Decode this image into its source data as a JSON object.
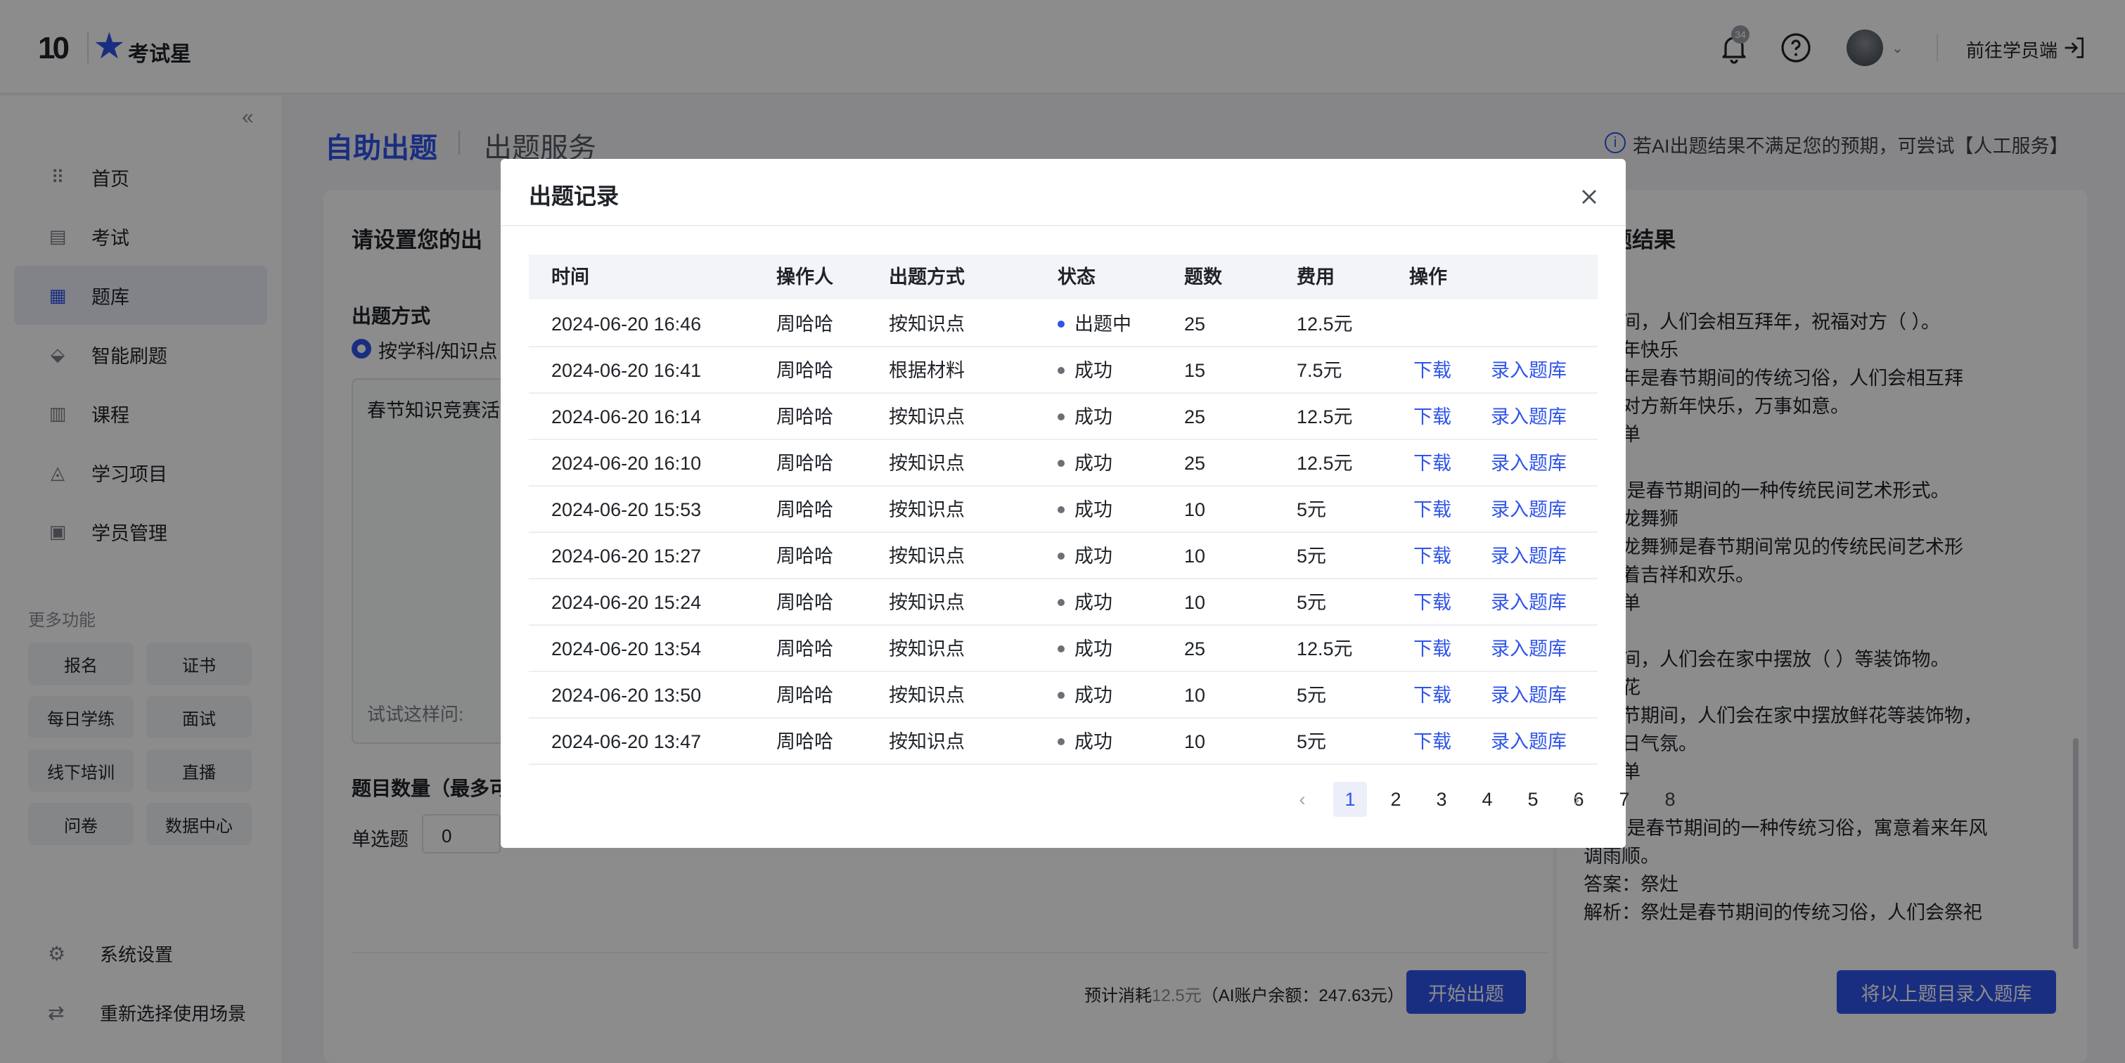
{
  "header": {
    "logo_mark": "10",
    "logo_text": "考试星",
    "notification_count": "34",
    "to_student": "前往学员端"
  },
  "sidebar": {
    "items": [
      {
        "label": "首页",
        "icon": "grid-icon"
      },
      {
        "label": "考试",
        "icon": "exam-icon"
      },
      {
        "label": "题库",
        "icon": "question-bank-icon"
      },
      {
        "label": "智能刷题",
        "icon": "smart-practice-icon"
      },
      {
        "label": "课程",
        "icon": "course-icon"
      },
      {
        "label": "学习项目",
        "icon": "project-icon"
      },
      {
        "label": "学员管理",
        "icon": "student-icon"
      }
    ],
    "more_title": "更多功能",
    "more": [
      "报名",
      "证书",
      "每日学练",
      "面试",
      "线下培训",
      "直播",
      "问卷",
      "数据中心"
    ],
    "footer": [
      {
        "label": "系统设置",
        "icon": "gear-icon"
      },
      {
        "label": "重新选择使用场景",
        "icon": "switch-icon"
      }
    ]
  },
  "page": {
    "title_main": "自助出题",
    "title_sub": "出题服务",
    "notice": "若AI出题结果不满足您的预期，可尝试【人工服务】",
    "card_title": "请设置您的出",
    "mode_label": "出题方式",
    "mode_option": "按学科/知识点",
    "topic_text": "春节知识竞赛活",
    "try_text": "试试这样问:",
    "qty_label": "题目数量（最多可",
    "single_label": "单选题",
    "single_value": "0",
    "cost_prefix": "预计消耗",
    "cost_amount": "12.5元",
    "cost_suffix": "（AI账户余额：247.63元）",
    "start_button": "开始出题",
    "result_title": "题结果",
    "result_lines": [
      "节期间，人们会相互拜年，祝福对方（ ）。",
      "：新年快乐",
      "：拜年是春节期间的传统习俗，人们会相互拜",
      "祝福对方新年快乐，万事如意。",
      "：简单",
      "",
      "（ ）是春节期间的一种传统民间艺术形式。",
      "：舞龙舞狮",
      "：舞龙舞狮是春节期间常见的传统民间艺术形",
      "象征着吉祥和欢乐。",
      "：简单",
      "",
      "节期间，人们会在家中摆放（ ）等装饰物。",
      "：鲜花",
      "：春节期间，人们会在家中摆放鲜花等装饰物，",
      "添节日气氛。",
      "：简单",
      "",
      "（ ）是春节期间的一种传统习俗，寓意着来年风",
      "调雨顺。",
      "答案：祭灶",
      "解析：祭灶是春节期间的传统习俗，人们会祭祀"
    ],
    "import_button": "将以上题目录入题库"
  },
  "modal": {
    "title": "出题记录",
    "columns": [
      "时间",
      "操作人",
      "出题方式",
      "状态",
      "题数",
      "费用",
      "操作"
    ],
    "rows": [
      {
        "time": "2024-06-20 16:46",
        "operator": "周哈哈",
        "method": "按知识点",
        "status": "出题中",
        "count": "25",
        "fee": "12.5元",
        "download": "",
        "import": ""
      },
      {
        "time": "2024-06-20 16:41",
        "operator": "周哈哈",
        "method": "根据材料",
        "status": "成功",
        "count": "15",
        "fee": "7.5元",
        "download": "下载",
        "import": "录入题库"
      },
      {
        "time": "2024-06-20 16:14",
        "operator": "周哈哈",
        "method": "按知识点",
        "status": "成功",
        "count": "25",
        "fee": "12.5元",
        "download": "下载",
        "import": "录入题库"
      },
      {
        "time": "2024-06-20 16:10",
        "operator": "周哈哈",
        "method": "按知识点",
        "status": "成功",
        "count": "25",
        "fee": "12.5元",
        "download": "下载",
        "import": "录入题库"
      },
      {
        "time": "2024-06-20 15:53",
        "operator": "周哈哈",
        "method": "按知识点",
        "status": "成功",
        "count": "10",
        "fee": "5元",
        "download": "下载",
        "import": "录入题库"
      },
      {
        "time": "2024-06-20 15:27",
        "operator": "周哈哈",
        "method": "按知识点",
        "status": "成功",
        "count": "10",
        "fee": "5元",
        "download": "下载",
        "import": "录入题库"
      },
      {
        "time": "2024-06-20 15:24",
        "operator": "周哈哈",
        "method": "按知识点",
        "status": "成功",
        "count": "10",
        "fee": "5元",
        "download": "下载",
        "import": "录入题库"
      },
      {
        "time": "2024-06-20 13:54",
        "operator": "周哈哈",
        "method": "按知识点",
        "status": "成功",
        "count": "25",
        "fee": "12.5元",
        "download": "下载",
        "import": "录入题库"
      },
      {
        "time": "2024-06-20 13:50",
        "operator": "周哈哈",
        "method": "按知识点",
        "status": "成功",
        "count": "10",
        "fee": "5元",
        "download": "下载",
        "import": "录入题库"
      },
      {
        "time": "2024-06-20 13:47",
        "operator": "周哈哈",
        "method": "按知识点",
        "status": "成功",
        "count": "10",
        "fee": "5元",
        "download": "下载",
        "import": "录入题库"
      }
    ],
    "pagination": {
      "pages": [
        "1",
        "2",
        "3",
        "4",
        "5",
        "6",
        "7",
        "8"
      ],
      "current": "1"
    }
  },
  "colors": {
    "accent": "#2f54eb",
    "status_running": "#2f54eb",
    "status_success": "#6b6f76"
  }
}
